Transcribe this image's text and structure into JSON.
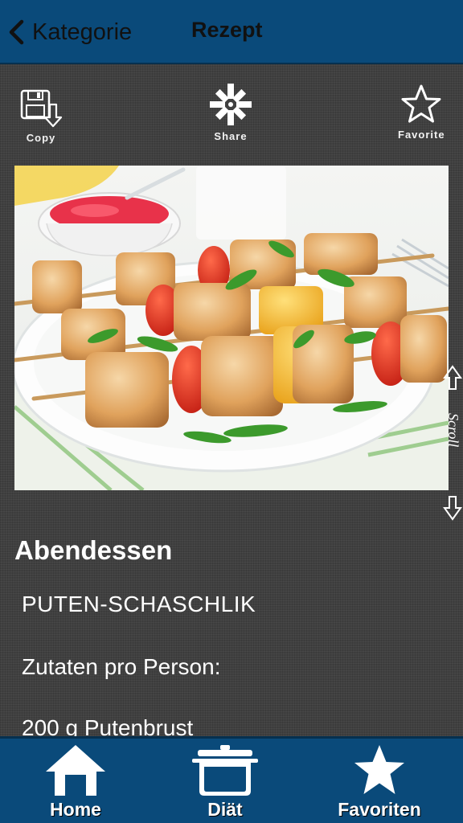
{
  "navbar": {
    "back_label": "Kategorie",
    "title": "Rezept"
  },
  "toolbar": {
    "copy_label": "Copy",
    "share_label": "Share",
    "favorite_label": "Favorite"
  },
  "scroll_hint": {
    "label": "Scroll"
  },
  "recipe": {
    "category": "Abendessen",
    "title": "PUTEN-SCHASCHLIK",
    "ingredients_heading": "Zutaten pro Person:",
    "first_ingredient": "200 g Putenbrust"
  },
  "tabbar": {
    "tabs": [
      {
        "label": "Home",
        "icon": "home-icon"
      },
      {
        "label": "Diät",
        "icon": "pot-icon"
      },
      {
        "label": "Favoriten",
        "icon": "star-icon"
      }
    ]
  },
  "colors": {
    "bar_blue": "#0a4a7a",
    "background_linen": "#404040",
    "text": "#ffffff"
  }
}
